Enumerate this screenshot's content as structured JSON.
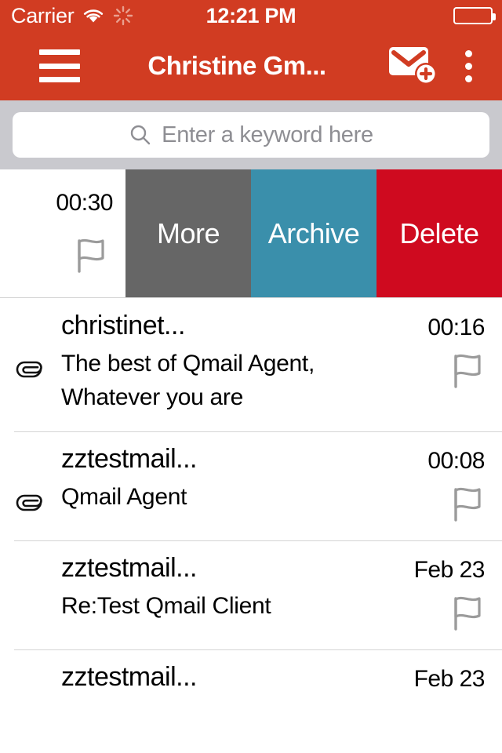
{
  "theme": {
    "header_red": "#D13C22",
    "search_bg": "#C9C9CE",
    "more_gray": "#666666",
    "archive_teal": "#3A8FAB",
    "delete_red": "#CF0A1F",
    "divider": "#D4D4D4",
    "placeholder_gray": "#8E8E93"
  },
  "status_bar": {
    "carrier": "Carrier",
    "wifi_icon": "wifi-icon",
    "activity_icon": "activity-spinner-icon",
    "time": "12:21 PM",
    "battery_icon": "battery-icon",
    "battery_level_percent": 0
  },
  "nav_bar": {
    "menu_icon": "hamburger-menu-icon",
    "title": "Christine Gm...",
    "compose_icon": "compose-mail-icon",
    "overflow_icon": "overflow-menu-icon"
  },
  "search": {
    "icon": "search-icon",
    "placeholder": "Enter a keyword here",
    "value": ""
  },
  "swipe_row": {
    "time": "00:30",
    "flag_icon": "flag-icon",
    "actions": [
      {
        "label": "More",
        "name": "more-action-button"
      },
      {
        "label": "Archive",
        "name": "archive-action-button"
      },
      {
        "label": "Delete",
        "name": "delete-action-button"
      }
    ]
  },
  "mail_list": {
    "rows": [
      {
        "sender": "christinet...",
        "date": "00:16",
        "subject": "The best of Qmail Agent,\nWhatever you are",
        "has_attachment": true,
        "attachment_icon": "paperclip-icon",
        "flag_icon": "flag-icon",
        "has_flag": true
      },
      {
        "sender": "zztestmail...",
        "date": "00:08",
        "subject": "Qmail Agent",
        "has_attachment": true,
        "attachment_icon": "paperclip-icon",
        "flag_icon": "flag-icon",
        "has_flag": true
      },
      {
        "sender": "zztestmail...",
        "date": "Feb 23",
        "subject": "Re:Test Qmail Client",
        "has_attachment": false,
        "attachment_icon": "",
        "flag_icon": "flag-icon",
        "has_flag": true
      },
      {
        "sender": "zztestmail...",
        "date": "Feb 23",
        "subject": "",
        "has_attachment": false,
        "attachment_icon": "",
        "flag_icon": "",
        "has_flag": false
      }
    ]
  }
}
